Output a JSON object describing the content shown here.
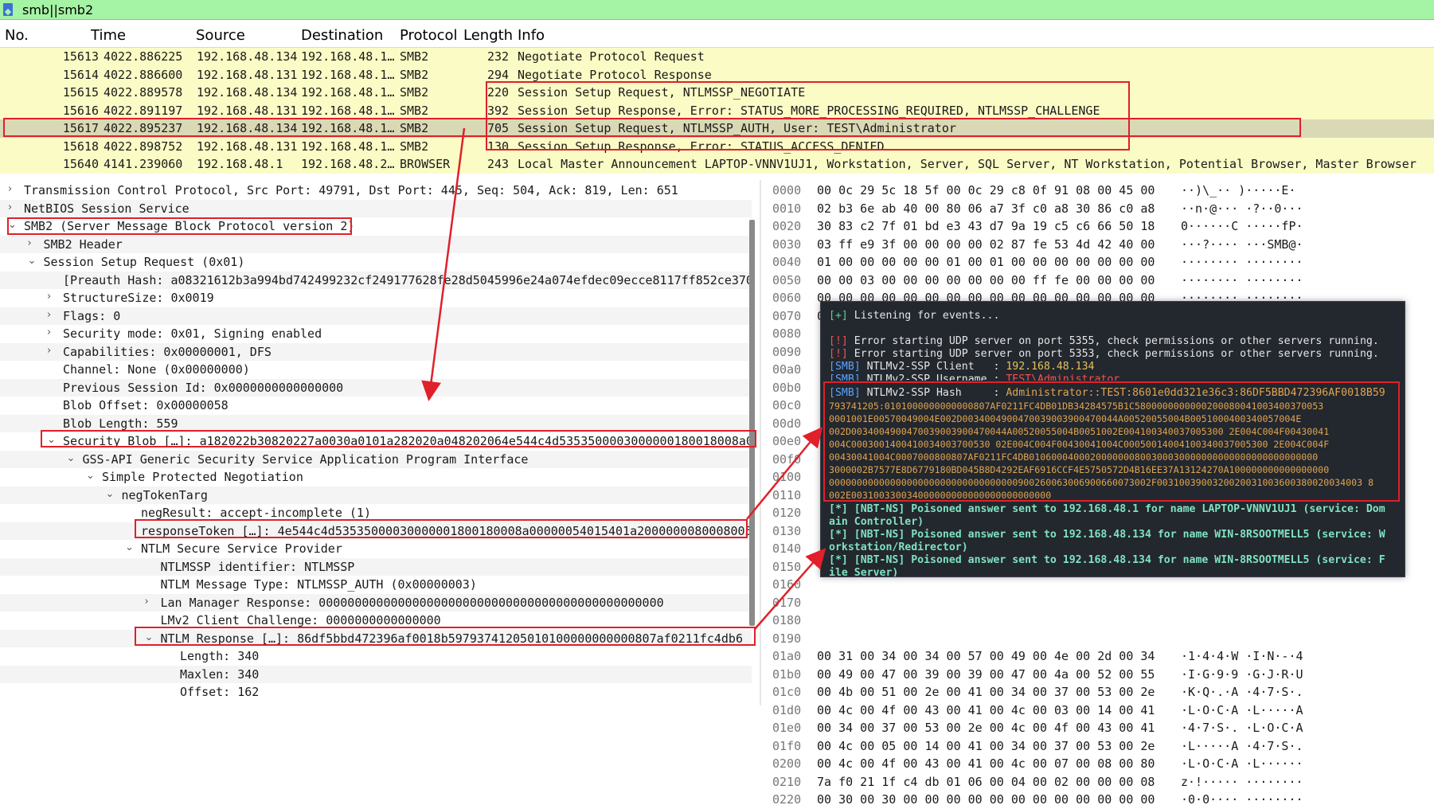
{
  "filter": {
    "value": "smb||smb2"
  },
  "packet_list": {
    "columns": [
      "No.",
      "Time",
      "Source",
      "Destination",
      "Protocol",
      "Length",
      "Info"
    ],
    "rows": [
      [
        "15613",
        "4022.886225",
        "192.168.48.134",
        "192.168.48.1…",
        "SMB2",
        "232",
        "Negotiate Protocol Request"
      ],
      [
        "15614",
        "4022.886600",
        "192.168.48.131",
        "192.168.48.1…",
        "SMB2",
        "294",
        "Negotiate Protocol Response"
      ],
      [
        "15615",
        "4022.889578",
        "192.168.48.134",
        "192.168.48.1…",
        "SMB2",
        "220",
        "Session Setup Request, NTLMSSP_NEGOTIATE"
      ],
      [
        "15616",
        "4022.891197",
        "192.168.48.131",
        "192.168.48.1…",
        "SMB2",
        "392",
        "Session Setup Response, Error: STATUS_MORE_PROCESSING_REQUIRED, NTLMSSP_CHALLENGE"
      ],
      [
        "15617",
        "4022.895237",
        "192.168.48.134",
        "192.168.48.1…",
        "SMB2",
        "705",
        "Session Setup Request, NTLMSSP_AUTH, User: TEST\\Administrator"
      ],
      [
        "15618",
        "4022.898752",
        "192.168.48.131",
        "192.168.48.1…",
        "SMB2",
        "130",
        "Session Setup Response, Error: STATUS_ACCESS_DENIED"
      ],
      [
        "15640",
        "4141.239060",
        "192.168.48.1",
        "192.168.48.2…",
        "BROWSER",
        "243",
        "Local Master Announcement LAPTOP-VNNV1UJ1, Workstation, Server, SQL Server, NT Workstation, Potential Browser, Master Browser"
      ]
    ],
    "selected_index": 4
  },
  "details": [
    {
      "indent": 0,
      "chev": "›",
      "text": "Transmission Control Protocol, Src Port: 49791, Dst Port: 445, Seq: 504, Ack: 819, Len: 651"
    },
    {
      "indent": 0,
      "chev": "›",
      "text": "NetBIOS Session Service"
    },
    {
      "indent": 0,
      "chev": "⌄",
      "text": "SMB2 (Server Message Block Protocol version 2)"
    },
    {
      "indent": 1,
      "chev": "›",
      "text": "SMB2 Header"
    },
    {
      "indent": 1,
      "chev": "⌄",
      "text": "Session Setup Request (0x01)"
    },
    {
      "indent": 2,
      "chev": "",
      "text": "[Preauth Hash: a08321612b3a994bd742499232cf249177628fe28d5045996e24a074efdec09ecce8117ff852ce370"
    },
    {
      "indent": 2,
      "chev": "›",
      "text": "StructureSize: 0x0019"
    },
    {
      "indent": 2,
      "chev": "›",
      "text": "Flags: 0"
    },
    {
      "indent": 2,
      "chev": "›",
      "text": "Security mode: 0x01, Signing enabled"
    },
    {
      "indent": 2,
      "chev": "›",
      "text": "Capabilities: 0x00000001, DFS"
    },
    {
      "indent": 2,
      "chev": "",
      "text": "Channel: None (0x00000000)"
    },
    {
      "indent": 2,
      "chev": "",
      "text": "Previous Session Id: 0x0000000000000000"
    },
    {
      "indent": 2,
      "chev": "",
      "text": "Blob Offset: 0x00000058"
    },
    {
      "indent": 2,
      "chev": "",
      "text": "Blob Length: 559"
    },
    {
      "indent": 2,
      "chev": "⌄",
      "text": "Security Blob […]: a182022b30820227a0030a0101a282020a048202064e544c4d5353500003000000180018008a0"
    },
    {
      "indent": 3,
      "chev": "⌄",
      "text": "GSS-API Generic Security Service Application Program Interface"
    },
    {
      "indent": 4,
      "chev": "⌄",
      "text": "Simple Protected Negotiation"
    },
    {
      "indent": 5,
      "chev": "⌄",
      "text": "negTokenTarg"
    },
    {
      "indent": 6,
      "chev": "",
      "text": "negResult: accept-incomplete (1)"
    },
    {
      "indent": 6,
      "chev": "",
      "text": "responseToken […]: 4e544c4d53535000030000001800180008a00000054015401a2000000080008005"
    },
    {
      "indent": 6,
      "chev": "⌄",
      "text": "NTLM Secure Service Provider"
    },
    {
      "indent": 7,
      "chev": "",
      "text": "NTLMSSP identifier: NTLMSSP"
    },
    {
      "indent": 7,
      "chev": "",
      "text": "NTLM Message Type: NTLMSSP_AUTH (0x00000003)"
    },
    {
      "indent": 7,
      "chev": "›",
      "text": "Lan Manager Response: 000000000000000000000000000000000000000000000000"
    },
    {
      "indent": 7,
      "chev": "",
      "text": "LMv2 Client Challenge: 0000000000000000"
    },
    {
      "indent": 7,
      "chev": "⌄",
      "text": "NTLM Response […]: 86df5bbd472396af0018b59793741205010100000000000807af0211fc4db6"
    },
    {
      "indent": 8,
      "chev": "",
      "text": "Length: 340"
    },
    {
      "indent": 8,
      "chev": "",
      "text": "Maxlen: 340"
    },
    {
      "indent": 8,
      "chev": "",
      "text": "Offset: 162"
    }
  ],
  "bytes": [
    [
      "0000",
      "00 0c 29 5c 18 5f 00 0c  29 c8 0f 91 08 00 45 00",
      "··)\\_·· )·····E·"
    ],
    [
      "0010",
      "02 b3 6e ab 40 00 80 06  a7 3f c0 a8 30 86 c0 a8",
      "··n·@··· ·?··0···"
    ],
    [
      "0020",
      "30 83 c2 7f 01 bd e3 43  d7 9a 19 c5 c6 66 50 18",
      "0······C ·····fP·"
    ],
    [
      "0030",
      "03 ff e9 3f 00 00 00 00  02 87 fe 53 4d 42 40 00",
      "···?···· ···SMB@·"
    ],
    [
      "0040",
      "01 00 00 00 00 00 01 00  01 00 00 00 00 00 00 00",
      "········ ········"
    ],
    [
      "0050",
      "00 00 03 00 00 00 00 00  00 00 ff fe 00 00 00 00",
      "········ ········"
    ],
    [
      "0060",
      "00 00 00 00 00 00 00 00  00 00 00 00 00 00 00 00",
      "········ ········"
    ],
    [
      "0070",
      "00 00 00 00 00 00 00 00  00 00 19 00 00 01 01 00",
      "········ ········"
    ],
    [
      "0080",
      "",
      ""
    ],
    [
      "0090",
      "",
      ""
    ],
    [
      "00a0",
      "",
      ""
    ],
    [
      "00b0",
      "",
      ""
    ],
    [
      "00c0",
      "",
      ""
    ],
    [
      "00d0",
      "",
      ""
    ],
    [
      "00e0",
      "",
      ""
    ],
    [
      "00f0",
      "",
      ""
    ],
    [
      "0100",
      "",
      ""
    ],
    [
      "0110",
      "",
      ""
    ],
    [
      "0120",
      "",
      ""
    ],
    [
      "0130",
      "",
      ""
    ],
    [
      "0140",
      "",
      ""
    ],
    [
      "0150",
      "",
      ""
    ],
    [
      "0160",
      "",
      ""
    ],
    [
      "0170",
      "",
      ""
    ],
    [
      "0180",
      "",
      ""
    ],
    [
      "0190",
      "",
      ""
    ],
    [
      "01a0",
      "00 31 00 34 00 34 00 57  00 49 00 4e 00 2d 00 34",
      "·1·4·4·W ·I·N·-·4"
    ],
    [
      "01b0",
      "00 49 00 47 00 39 00 39  00 47 00 4a 00 52 00 55",
      "·I·G·9·9 ·G·J·R·U"
    ],
    [
      "01c0",
      "00 4b 00 51 00 2e 00 41  00 34 00 37 00 53 00 2e",
      "·K·Q·.·A ·4·7·S·."
    ],
    [
      "01d0",
      "00 4c 00 4f 00 43 00 41  00 4c 00 03 00 14 00 41",
      "·L·O·C·A ·L·····A"
    ],
    [
      "01e0",
      "00 34 00 37 00 53 00 2e  00 4c 00 4f 00 43 00 41",
      "·4·7·S·. ·L·O·C·A"
    ],
    [
      "01f0",
      "00 4c 00 05 00 14 00 41  00 34 00 37 00 53 00 2e",
      "·L·····A ·4·7·S·."
    ],
    [
      "0200",
      "00 4c 00 4f 00 43 00 41  00 4c 00 07 00 08 00 80",
      "·L·O·C·A ·L······"
    ],
    [
      "0210",
      "7a f0 21 1f c4 db 01 06  00 04 00 02 00 00 00 08",
      "z·!····· ········"
    ],
    [
      "0220",
      "00 30 00 30 00 00 00 00  00 00 00 00 00 00 00 00",
      "·0·0···· ········"
    ]
  ],
  "terminal": {
    "l1": "Listening for events...",
    "l2": "Error starting UDP server on port 5355, check permissions or other servers running.",
    "l3": "Error starting UDP server on port 5353, check permissions or other servers running.",
    "l4_label": "NTLMv2-SSP Client   : ",
    "l4_val": "192.168.48.134",
    "l5_label": "NTLMv2-SSP Username : ",
    "l5_val": "TEST\\Administrator",
    "l6_label": "NTLMv2-SSP Hash     : ",
    "hash_lines": [
      "Administrator::TEST:8601e0dd321e36c3:86DF5BBD472396AF0018B59",
      "793741205:0101000000000000807AF0211FC4DB01DB34284575B1C5800000000000200080041003400370053",
      "0001001E00570049004E002D0034004900470039003900470044A00520055004B0051000400340057004E",
      "002D0034004900470039003900470044A00520055004B0051002E004100340037005300 2E004C004F00430041",
      "004C0003001400410034003700530 02E004C004F00430041004C00050014004100340037005300 2E004C004F",
      "00430041004C0007000800807AF0211FC4DB0106000400020000000800300030000000000000000000000000",
      "3000002B7577E8D6779180BD045B8D4292EAF6916CCF4E5750572D4B16EE37A13124270A100000000000000000",
      "0000000000000000000000000000000000900260063006900660073002F0031003900320020031003600380020034003 8",
      "002E003100330034000000000000000000000000"
    ],
    "p1": "[*] [NBT-NS] Poisoned answer sent to 192.168.48.1 for name LAPTOP-VNNV1UJ1 (service: Dom",
    "p1b": "ain Controller)",
    "p2": "[*] [NBT-NS] Poisoned answer sent to 192.168.48.134 for name WIN-8RSOOTMELL5 (service: W",
    "p2b": "orkstation/Redirector)",
    "p3": "[*] [NBT-NS] Poisoned answer sent to 192.168.48.134 for name WIN-8RSOOTMELL5 (service: F",
    "p3b": "ile Server)",
    "tag_plus": "[+]",
    "tag_err": "[!]",
    "tag_smb": "[SMB]"
  },
  "colors": {
    "annotation": "#e0202a",
    "filter_bg": "#a5f3a5",
    "row_bg": "#fbfbc6",
    "terminal_bg": "#23272e"
  }
}
